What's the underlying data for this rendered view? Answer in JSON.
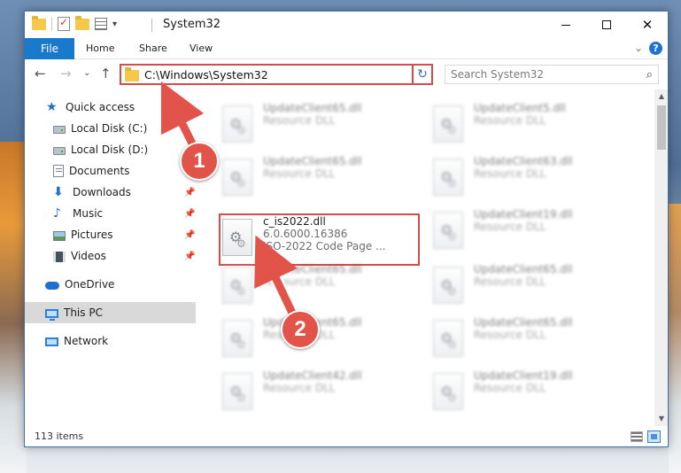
{
  "window": {
    "title": "System32"
  },
  "ribbon": {
    "tabs": [
      "File",
      "Home",
      "Share",
      "View"
    ],
    "help": "?"
  },
  "address": {
    "path": "C:\\Windows\\System32"
  },
  "search": {
    "placeholder": "Search System32"
  },
  "navpane": {
    "items": [
      {
        "label": "Quick access"
      },
      {
        "label": "Local Disk (C:)"
      },
      {
        "label": "Local Disk (D:)"
      },
      {
        "label": "Documents"
      },
      {
        "label": "Downloads"
      },
      {
        "label": "Music"
      },
      {
        "label": "Pictures"
      },
      {
        "label": "Videos"
      },
      {
        "label": "OneDrive"
      },
      {
        "label": "This PC"
      },
      {
        "label": "Network"
      }
    ]
  },
  "files": [
    {
      "name": "UpdateClient65.dll",
      "type": "Resource DLL"
    },
    {
      "name": "UpdateClient5.dll",
      "type": "Resource DLL"
    },
    {
      "name": "UpdateClient65.dll",
      "type": "Resource DLL"
    },
    {
      "name": "UpdateClient63.dll",
      "type": "Resource DLL"
    },
    {
      "name": "c_is2022.dll",
      "version": "6.0.6000.16386",
      "type": "ISO-2022 Code Page ..."
    },
    {
      "name": "UpdateClient19.dll",
      "type": "Resource DLL"
    },
    {
      "name": "UpdateClient65.dll",
      "type": "Resource DLL"
    },
    {
      "name": "UpdateClient65.dll",
      "type": "Resource DLL"
    },
    {
      "name": "UpdateClient65.dll",
      "type": "Resource DLL"
    },
    {
      "name": "UpdateClient65.dll",
      "type": "Resource DLL"
    },
    {
      "name": "UpdateClient42.dll",
      "type": "Resource DLL"
    },
    {
      "name": "UpdateClient19.dll",
      "type": "Resource DLL"
    }
  ],
  "status": {
    "count": "113 items"
  },
  "annotations": {
    "step1": "1",
    "step2": "2"
  },
  "colors": {
    "accent": "#1979ca",
    "highlight": "#d94a4a",
    "badge": "#e2534a"
  }
}
